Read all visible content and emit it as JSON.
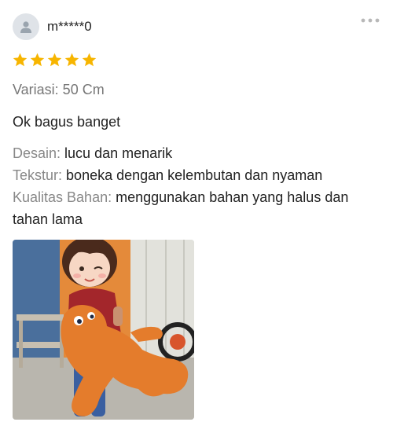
{
  "review": {
    "username": "m*****0",
    "rating": 5,
    "variant": "Variasi: 50 Cm",
    "comment": "Ok bagus banget",
    "attributes": [
      {
        "label": "Desain:",
        "value": "lucu dan menarik"
      },
      {
        "label": "Tekstur:",
        "value": "boneka dengan kelembutan dan nyaman"
      },
      {
        "label": "Kualitas Bahan:",
        "value": "menggunakan bahan yang halus dan tahan lama"
      }
    ]
  },
  "icons": {
    "avatar": "person-icon",
    "more": "more-horizontal-icon",
    "star": "star-icon"
  },
  "colors": {
    "star": "#f7b500",
    "avatar_bg": "#dfe3e8",
    "label": "#888888",
    "text": "#222222"
  }
}
